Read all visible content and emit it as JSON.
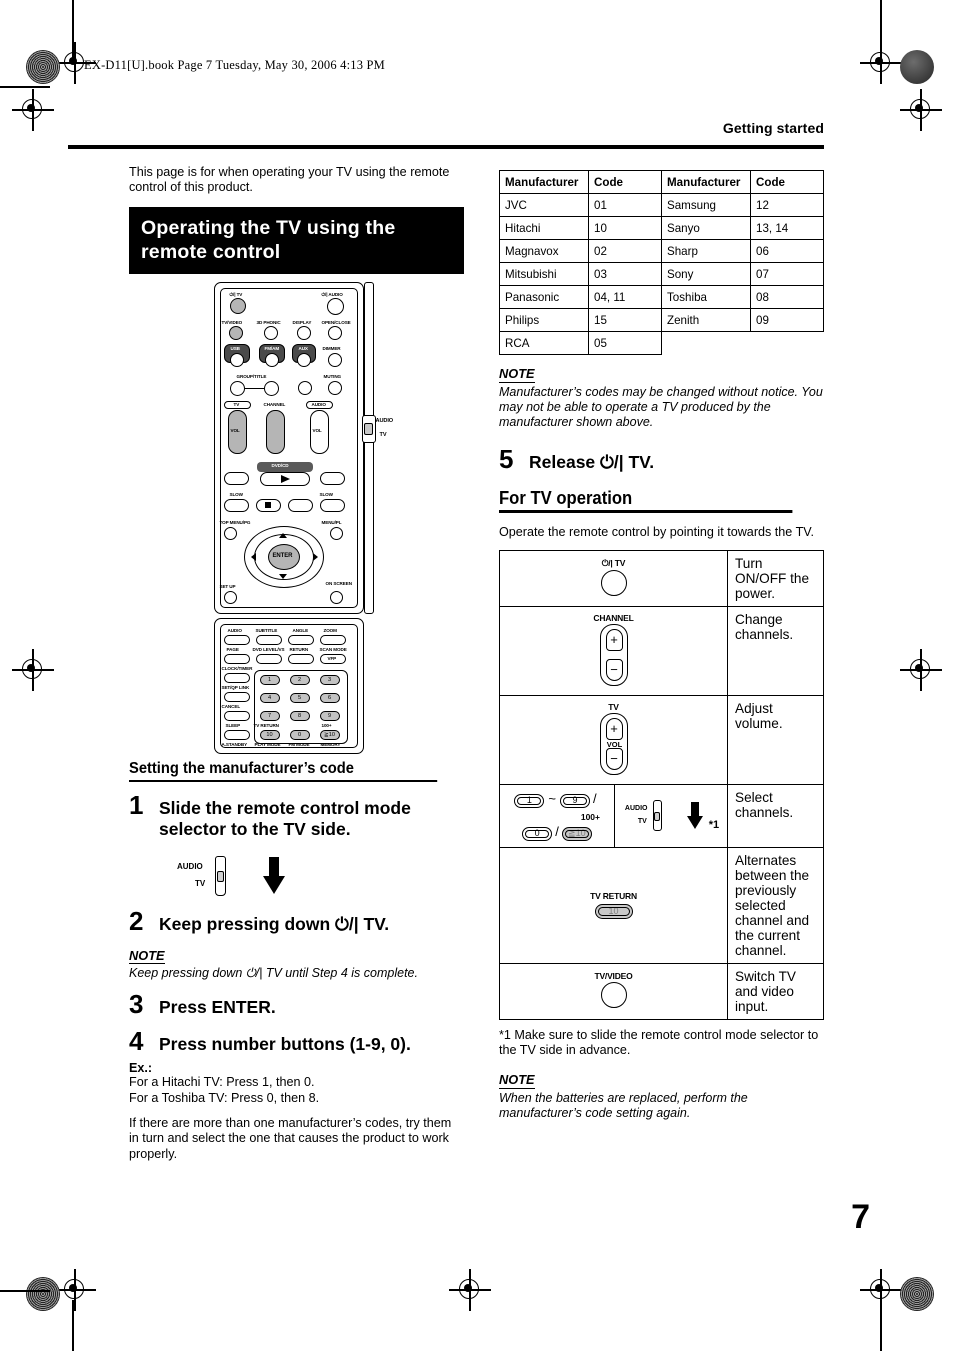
{
  "print_marks": {
    "file_line": "EX-D11[U].book  Page 7  Tuesday, May 30, 2006  4:13 PM"
  },
  "header": {
    "running_head": "Getting started",
    "page_number": "7"
  },
  "left_column": {
    "intro": "This page is for when operating your TV using the remote control of this product.",
    "title_band": "Operating the TV using the remote control",
    "section_heading": "Setting the manufacturer’s code",
    "steps": [
      {
        "n": "1",
        "text": "Slide the remote control mode selector to the TV side."
      },
      {
        "n": "2",
        "text": "Keep pressing down ⏻/| TV."
      },
      {
        "n": "3",
        "text": "Press ENTER."
      },
      {
        "n": "4",
        "text": "Press number buttons (1-9, 0)."
      }
    ],
    "note2_heading": "NOTE",
    "note2_body": "Keep pressing down ⏻/| TV until Step 4 is complete.",
    "example_label": "Ex.:",
    "example_lines": [
      "For a Hitachi TV: Press 1, then 0.",
      "For a Toshiba TV: Press 0, then 8."
    ],
    "closing": "If there are more than one manufacturer’s codes, try them in turn and select the one that causes the product to work properly."
  },
  "remote": {
    "labels": {
      "power_tv": "⏻/| TV",
      "power_audio": "⏻/| AUDIO",
      "tv_video": "TV/VIDEO",
      "phonic": "3D PHONIC",
      "display": "DISPLAY",
      "open_close": "OPEN/CLOSE",
      "usb": "USB",
      "fm_am": "FM/AM",
      "aux": "AUX",
      "dimmer": "DIMMER",
      "group_title": "GROUP/TITLE",
      "muting": "MUTING",
      "tv": "TV",
      "channel": "CHANNEL",
      "audio": "AUDIO",
      "vol": "VOL",
      "dvd_cd": "DVD/CD",
      "slow_left": "SLOW",
      "slow_right": "SLOW",
      "top_menu": "TOP MENU/PG",
      "menu_pl": "MENU/PL",
      "enter": "ENTER",
      "set_up": "SET UP",
      "on_screen": "ON SCREEN",
      "audio2": "AUDIO",
      "subtitle": "SUBTITLE",
      "angle": "ANGLE",
      "zoom": "ZOOM",
      "page": "PAGE",
      "dvd_level": "DVD LEVEL/VS",
      "return": "RETURN",
      "scan_mode": "SCAN MODE",
      "vfp": "VFP",
      "clock_timer": "CLOCK/TIMER",
      "setup_link": "SET/QP LINK",
      "cancel": "CANCEL",
      "sleep": "SLEEP",
      "tv_return": "TV RETURN",
      "hundred_plus": "100+",
      "a_standby": "A.STANDBY",
      "play_mode": "PLAY MODE",
      "fm_mode": "FM MODE",
      "memory": "MEMORY",
      "numbers": [
        "1",
        "2",
        "3",
        "4",
        "5",
        "6",
        "7",
        "8",
        "9",
        "10",
        "0",
        "≧10"
      ]
    },
    "selector": {
      "audio": "AUDIO",
      "tv": "TV"
    }
  },
  "right_column": {
    "manufacturer_table": {
      "headers": [
        "Manufacturer",
        "Code",
        "Manufacturer",
        "Code"
      ],
      "rows": [
        [
          "JVC",
          "01",
          "Samsung",
          "12"
        ],
        [
          "Hitachi",
          "10",
          "Sanyo",
          "13, 14"
        ],
        [
          "Magnavox",
          "02",
          "Sharp",
          "06"
        ],
        [
          "Mitsubishi",
          "03",
          "Sony",
          "07"
        ],
        [
          "Panasonic",
          "04, 11",
          "Toshiba",
          "08"
        ],
        [
          "Philips",
          "15",
          "Zenith",
          "09"
        ],
        [
          "RCA",
          "05",
          "",
          ""
        ]
      ]
    },
    "note1_heading": "NOTE",
    "note1_body": "Manufacturer’s codes may be changed without notice. You may not be able to operate a TV produced by the manufacturer shown above.",
    "step5": {
      "n": "5",
      "text": "Release ⏻/| TV."
    },
    "section_heading": "For TV operation",
    "intro": "Operate the remote control by pointing it towards the TV.",
    "operation_table": [
      {
        "icon": "power-tv-button",
        "icon_label": "⏻/| TV",
        "description": "Turn ON/OFF the power."
      },
      {
        "icon": "channel-rocker",
        "icon_label": "CHANNEL",
        "description": "Change channels."
      },
      {
        "icon": "tv-volume-rocker",
        "icon_label": "TV",
        "icon_label2": "VOL",
        "description": "Adjust volume."
      },
      {
        "icon": "number-buttons",
        "icon_label": "1 ~ 9 / 0 / ≧10",
        "icon_label2": "100+",
        "footnote_ref": "*1",
        "description": "Select channels."
      },
      {
        "icon": "tv-return-button",
        "icon_label": "TV RETURN",
        "icon_label2": "10",
        "description": "Alternates between the previously selected channel and the current channel."
      },
      {
        "icon": "tv-video-button",
        "icon_label": "TV/VIDEO",
        "description": "Switch TV and video input."
      }
    ],
    "footnote": "*1 Make sure to slide the remote control mode selector to the TV side in advance.",
    "note3_heading": "NOTE",
    "note3_body": "When the batteries are replaced, perform the manufacturer’s code setting again."
  }
}
